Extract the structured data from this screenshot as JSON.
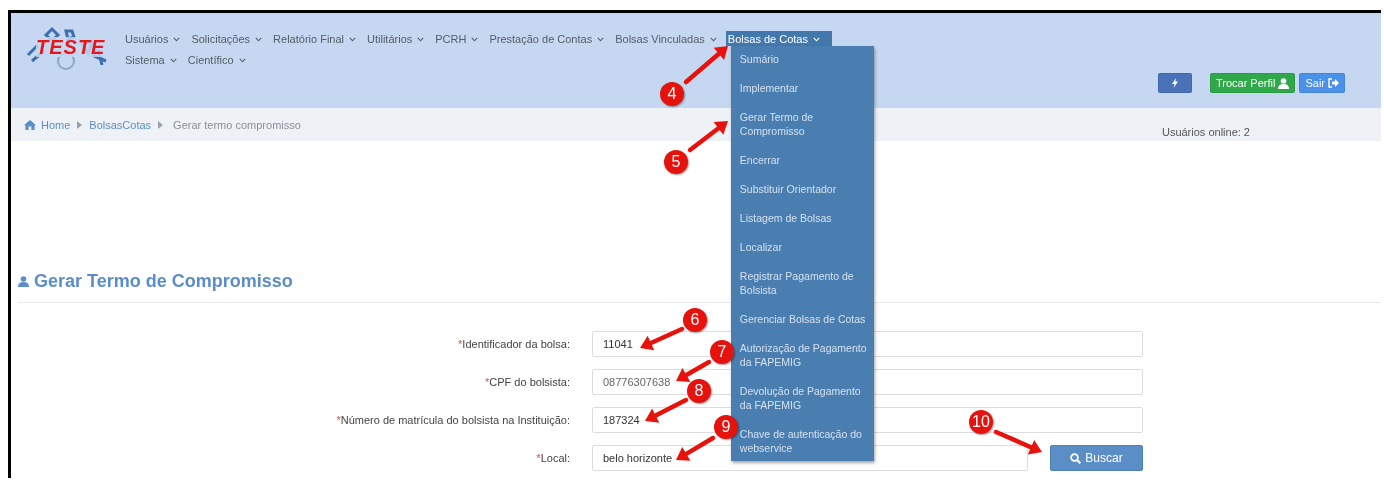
{
  "logo": {
    "text": "TESTE"
  },
  "menu_rows": [
    [
      {
        "label": "Usuários",
        "selected": false
      },
      {
        "label": "Solicitações",
        "selected": false
      },
      {
        "label": "Relatório Final",
        "selected": false
      },
      {
        "label": "Utilitários",
        "selected": false
      },
      {
        "label": "PCRH",
        "selected": false
      },
      {
        "label": "Prestação de Contas",
        "selected": false
      },
      {
        "label": "Bolsas Vinculadas",
        "selected": false
      },
      {
        "label": "Bolsas de Cotas",
        "selected": true,
        "expanded": true,
        "children": [
          {
            "label": "Sumário"
          },
          {
            "label": "Implementar"
          },
          {
            "label": "Gerar Termo de Compromisso"
          },
          {
            "label": "Encerrar"
          },
          {
            "label": "Substituir Orientador"
          },
          {
            "label": "Listagem de Bolsas"
          },
          {
            "label": "Localizar"
          },
          {
            "label": "Registrar Pagamento de Bolsista"
          },
          {
            "label": "Gerenciar Bolsas de Cotas"
          },
          {
            "label": "Autorização de Pagamento da FAPEMIG"
          },
          {
            "label": "Devolução de Pagamento da FAPEMIG"
          },
          {
            "label": "Chave de autenticação do webservice"
          }
        ]
      }
    ],
    [
      {
        "label": "Sistema",
        "selected": false
      },
      {
        "label": "Científico",
        "selected": false
      }
    ]
  ],
  "header_buttons": [
    {
      "kind": "icon"
    },
    {
      "kind": "profile",
      "label": "Trocar Perfil"
    },
    {
      "kind": "logout",
      "label": "Sair"
    }
  ],
  "breadcrumb": [
    {
      "label": "Home",
      "kind": "home"
    },
    {
      "label": "BolsasCotas",
      "kind": "link"
    },
    {
      "label": "Gerar termo compromisso",
      "kind": "current"
    }
  ],
  "online_users": "Usuários online: 2",
  "page_title": "Gerar Termo de Compromisso",
  "form": {
    "fields": [
      {
        "required_mark": "*",
        "label": "Identificador da bolsa:",
        "value": "11041",
        "blurred": false
      },
      {
        "required_mark": "*",
        "label": "CPF do bolsista:",
        "value": "08776307638",
        "blurred": true
      },
      {
        "required_mark": "*",
        "label": "Número de matrícula do bolsista na Instituição:",
        "value": "187324",
        "blurred": false
      },
      {
        "required_mark": "*",
        "label": "Local:",
        "value": "belo horizonte",
        "blurred": false
      }
    ],
    "submit_button": "Buscar"
  },
  "callouts": [
    {
      "number": "4"
    },
    {
      "number": "5"
    },
    {
      "number": "6"
    },
    {
      "number": "7"
    },
    {
      "number": "8"
    },
    {
      "number": "9"
    },
    {
      "number": "10"
    }
  ]
}
